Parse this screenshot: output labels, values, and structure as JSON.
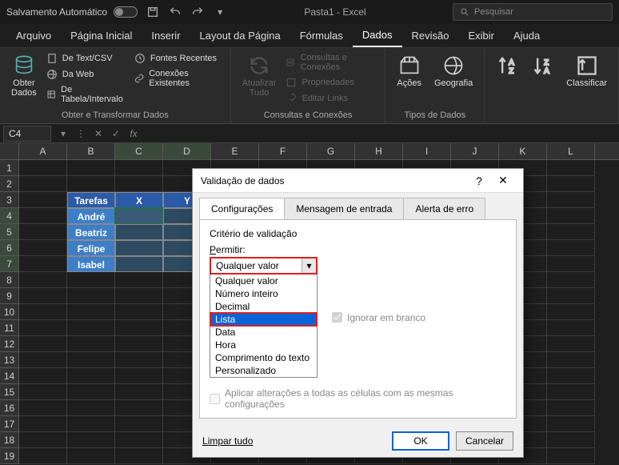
{
  "titlebar": {
    "autosave": "Salvamento Automático",
    "doc_title": "Pasta1 - Excel",
    "search_placeholder": "Pesquisar"
  },
  "tabs": {
    "arquivo": "Arquivo",
    "pagina_inicial": "Página Inicial",
    "inserir": "Inserir",
    "layout": "Layout da Página",
    "formulas": "Fórmulas",
    "dados": "Dados",
    "revisao": "Revisão",
    "exibir": "Exibir",
    "ajuda": "Ajuda"
  },
  "ribbon": {
    "obter_dados": "Obter\nDados",
    "text_csv": "De Text/CSV",
    "da_web": "Da Web",
    "tabela": "De Tabela/Intervalo",
    "fontes_recentes": "Fontes Recentes",
    "conexoes_exist": "Conexões Existentes",
    "group1": "Obter e Transformar Dados",
    "atualizar": "Atualizar\nTudo",
    "consultas_conexoes": "Consultas e Conexões",
    "propriedades": "Propriedades",
    "editar_links": "Editar Links",
    "group2": "Consultas e Conexões",
    "acoes": "Ações",
    "geografia": "Geografia",
    "group3": "Tipos de Dados",
    "classificar": "Classificar"
  },
  "fxbar": {
    "name": "C4",
    "fx": "fx"
  },
  "columns": [
    "A",
    "B",
    "C",
    "D",
    "E",
    "F",
    "G",
    "H",
    "I",
    "J",
    "K",
    "L"
  ],
  "table": {
    "headers": [
      "Tarefas",
      "X",
      "Y"
    ],
    "rows": [
      "André",
      "Beatriz",
      "Felipe",
      "Isabel"
    ]
  },
  "dialog": {
    "title": "Validação de dados",
    "tab_config": "Configurações",
    "tab_msg": "Mensagem de entrada",
    "tab_alerta": "Alerta de erro",
    "criterio": "Critério de validação",
    "permitir": "Permitir:",
    "selected": "Qualquer valor",
    "ignorar": "Ignorar em branco",
    "options": [
      "Qualquer valor",
      "Número inteiro",
      "Decimal",
      "Lista",
      "Data",
      "Hora",
      "Comprimento do texto",
      "Personalizado"
    ],
    "aplicar": "Aplicar alterações a todas as células com as mesmas configurações",
    "limpar": "Limpar tudo",
    "ok": "OK",
    "cancelar": "Cancelar"
  }
}
